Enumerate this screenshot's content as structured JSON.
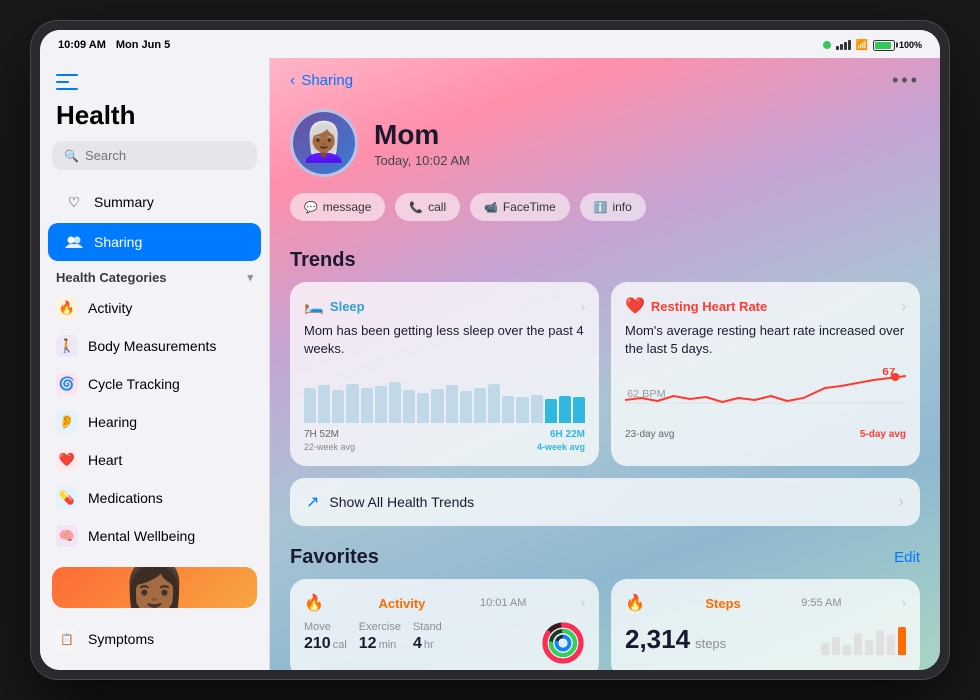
{
  "statusBar": {
    "time": "10:09 AM",
    "date": "Mon Jun 5",
    "battery": "100%",
    "dots": "•••"
  },
  "sidebar": {
    "appTitle": "Health",
    "searchPlaceholder": "Search",
    "navItems": [
      {
        "id": "summary",
        "label": "Summary",
        "icon": "♡"
      },
      {
        "id": "sharing",
        "label": "Sharing",
        "icon": "👥",
        "active": true
      }
    ],
    "healthCategories": {
      "label": "Health Categories",
      "items": [
        {
          "id": "activity",
          "label": "Activity",
          "icon": "🔥",
          "color": "#ff6b00"
        },
        {
          "id": "body",
          "label": "Body Measurements",
          "icon": "🚶",
          "color": "#5856d6"
        },
        {
          "id": "cycle",
          "label": "Cycle Tracking",
          "icon": "🌸",
          "color": "#ff2d55"
        },
        {
          "id": "hearing",
          "label": "Hearing",
          "icon": "👂",
          "color": "#5ac8fa"
        },
        {
          "id": "heart",
          "label": "Heart",
          "icon": "❤️",
          "color": "#ff3b30"
        },
        {
          "id": "medications",
          "label": "Medications",
          "icon": "💊",
          "color": "#34aadc"
        },
        {
          "id": "mental",
          "label": "Mental Wellbeing",
          "icon": "🧠",
          "color": "#af52de"
        }
      ]
    },
    "symptoms": "Symptoms"
  },
  "content": {
    "backLabel": "Sharing",
    "profile": {
      "name": "Mom",
      "time": "Today, 10:02 AM",
      "emoji": "👩🏾‍🦳"
    },
    "actions": [
      {
        "id": "message",
        "label": "message",
        "icon": "💬"
      },
      {
        "id": "call",
        "label": "call",
        "icon": "📞"
      },
      {
        "id": "facetime",
        "label": "FaceTime",
        "icon": "📹"
      },
      {
        "id": "info",
        "label": "info",
        "icon": "ℹ️"
      }
    ],
    "trends": {
      "title": "Trends",
      "cards": [
        {
          "id": "sleep",
          "label": "Sleep",
          "icon": "🛏️",
          "color": "#30a0c8",
          "description": "Mom has been getting less sleep over the past 4 weeks.",
          "highlightValue": "6H 22M",
          "avgLabel": "7H 52M",
          "leftLabel": "22-week avg",
          "rightLabel": "4-week avg"
        },
        {
          "id": "heart",
          "label": "Resting Heart Rate",
          "icon": "❤️",
          "color": "#ff3b30",
          "description": "Mom's average resting heart rate increased over the last 5 days.",
          "highlightValue": "67",
          "avgLabel": "62 BPM",
          "leftLabel": "23-day avg",
          "rightLabel": "5-day avg"
        }
      ]
    },
    "showAllTrends": "Show All Health Trends",
    "favorites": {
      "title": "Favorites",
      "editLabel": "Edit",
      "cards": [
        {
          "id": "activity",
          "title": "Activity",
          "time": "10:01 AM",
          "metrics": [
            {
              "label": "Move",
              "value": "210",
              "unit": "cal"
            },
            {
              "label": "Exercise",
              "value": "12",
              "unit": "min"
            },
            {
              "label": "Stand",
              "value": "4",
              "unit": "hr"
            }
          ]
        },
        {
          "id": "steps",
          "title": "Steps",
          "time": "9:55 AM",
          "value": "2,314",
          "unit": "steps"
        }
      ]
    }
  }
}
